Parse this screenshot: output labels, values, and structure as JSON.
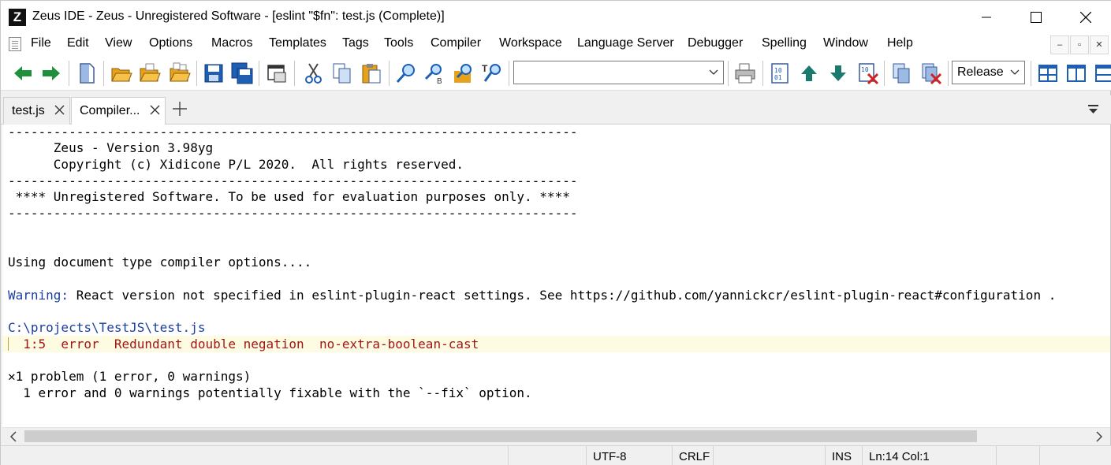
{
  "window": {
    "app_icon": "Z",
    "title": "Zeus IDE - Zeus - Unregistered Software - [eslint \"$fn\": test.js (Complete)]",
    "controls": [
      "minimize-icon",
      "maximize-icon",
      "close-icon"
    ]
  },
  "menu": {
    "items": [
      {
        "label": "File"
      },
      {
        "label": "Edit"
      },
      {
        "label": "View"
      },
      {
        "label": "Options"
      },
      {
        "label": "Macros"
      },
      {
        "label": "Templates"
      },
      {
        "label": "Tags"
      },
      {
        "label": "Tools"
      },
      {
        "label": "Compiler"
      },
      {
        "label": "Workspace"
      },
      {
        "label": "Language Server"
      },
      {
        "label": "Debugger"
      },
      {
        "label": "Spelling"
      },
      {
        "label": "Window"
      },
      {
        "label": "Help"
      }
    ],
    "mdi_buttons": [
      "–",
      "▫",
      "✕"
    ]
  },
  "toolbar": {
    "search_combo_value": "",
    "config_combo_value": "Release",
    "icons": [
      "back-arrow-icon",
      "forward-arrow-icon",
      "new-document-icon",
      "open-folder-icon",
      "open-folder-2-icon",
      "open-folder-3-icon",
      "save-icon",
      "save-all-icon",
      "print-window-icon",
      "cut-icon",
      "copy-icon",
      "paste-icon",
      "find-icon",
      "replace-icon",
      "find-in-files-icon",
      "find-text-icon",
      "printer-icon",
      "compile-icon",
      "arrow-up-icon",
      "arrow-down-icon",
      "stop-compile-icon",
      "copy-files-icon",
      "delete-files-icon",
      "layout-grid-icon",
      "layout-columns-icon",
      "layout-rows-icon"
    ],
    "accent_green": "#1e8f3a",
    "accent_orange": "#e7a21b",
    "accent_blue": "#1e5fb4",
    "accent_teal": "#1a7a6e",
    "accent_red": "#d02020"
  },
  "tabs": [
    {
      "label": "test.js",
      "active": false
    },
    {
      "label": "Compiler...",
      "active": true
    }
  ],
  "output": {
    "lines": [
      "---------------------------------------------------------------------------",
      "      Zeus - Version 3.98yg",
      "      Copyright (c) Xidicone P/L 2020.  All rights reserved.",
      "---------------------------------------------------------------------------",
      " **** Unregistered Software. To be used for evaluation purposes only. ****",
      "---------------------------------------------------------------------------",
      "Using document type compiler options....",
      "React version not specified in eslint-plugin-react settings. See https://github.com/yannickcr/eslint-plugin-react#configuration .",
      "C:\\projects\\TestJS\\test.js",
      "  1:5  error  Redundant double negation  no-extra-boolean-cast",
      "1 problem (1 error, 0 warnings)",
      "  1 error and 0 warnings potentially fixable with the `--fix` option."
    ],
    "warning_label": "Warning:",
    "problem_marker": "✕"
  },
  "status": {
    "encoding": "UTF-8",
    "line_ending": "CRLF",
    "insert_mode": "INS",
    "position": "Ln:14 Col:1"
  }
}
